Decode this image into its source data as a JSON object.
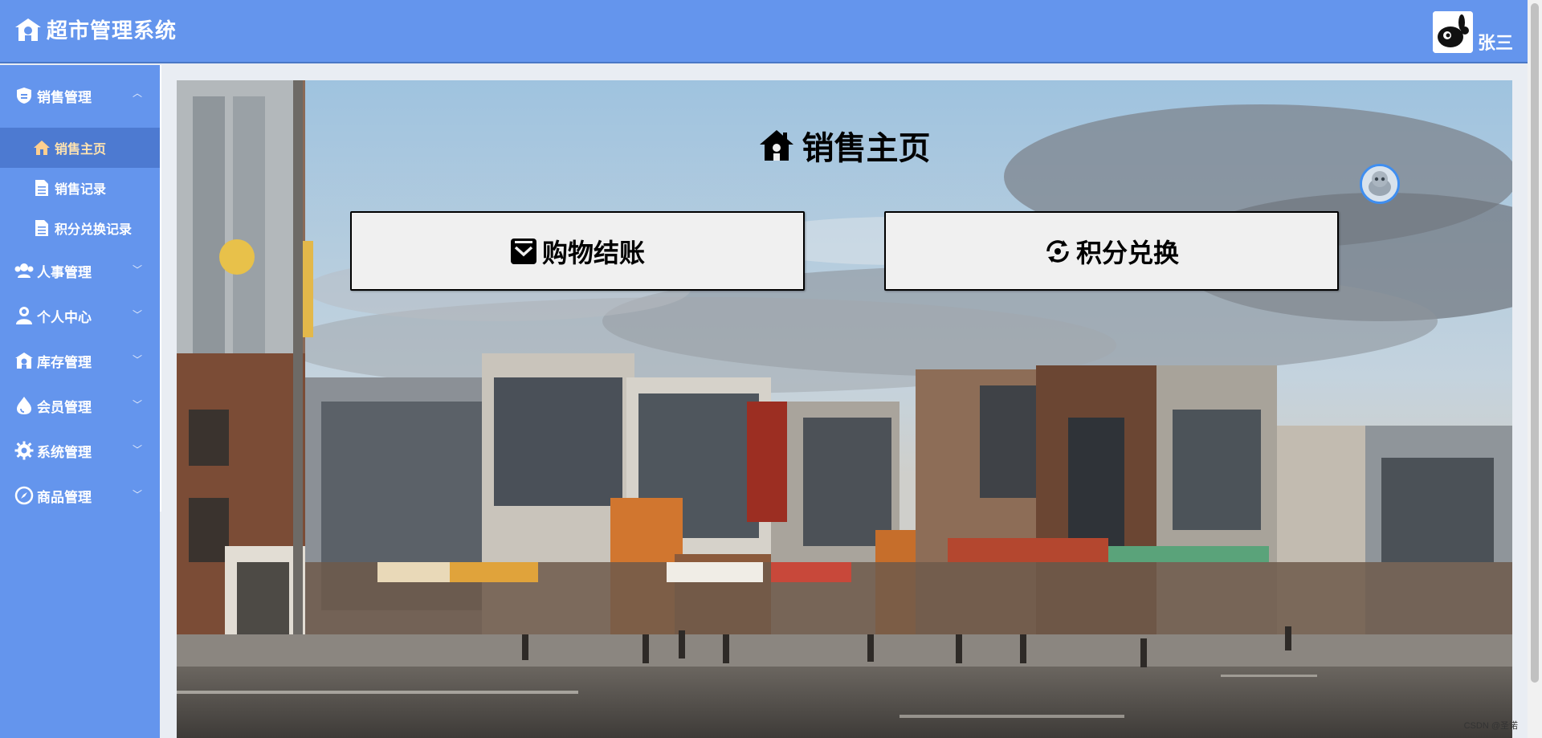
{
  "app": {
    "title": "超市管理系统"
  },
  "user": {
    "name": "张三"
  },
  "sidebar": {
    "groups": [
      {
        "label": "销售管理",
        "icon": "shield-icon",
        "expanded": true,
        "items": [
          {
            "label": "销售主页",
            "icon": "home-icon",
            "active": true
          },
          {
            "label": "销售记录",
            "icon": "document-icon",
            "active": false
          },
          {
            "label": "积分兑换记录",
            "icon": "document-icon",
            "active": false
          }
        ]
      },
      {
        "label": "人事管理",
        "icon": "users-icon",
        "expanded": false
      },
      {
        "label": "个人中心",
        "icon": "person-icon",
        "expanded": false
      },
      {
        "label": "库存管理",
        "icon": "warehouse-icon",
        "expanded": false
      },
      {
        "label": "会员管理",
        "icon": "drop-icon",
        "expanded": false
      },
      {
        "label": "系统管理",
        "icon": "gear-icon",
        "expanded": false
      },
      {
        "label": "商品管理",
        "icon": "compass-icon",
        "expanded": false
      }
    ]
  },
  "main": {
    "title": "销售主页",
    "buttons": {
      "checkout": "购物结账",
      "exchange": "积分兑换"
    }
  },
  "watermark": "CSDN @圣诺",
  "colors": {
    "primary": "#6495ed",
    "active": "#4d7ad1",
    "active_text": "#ffe3b0"
  }
}
